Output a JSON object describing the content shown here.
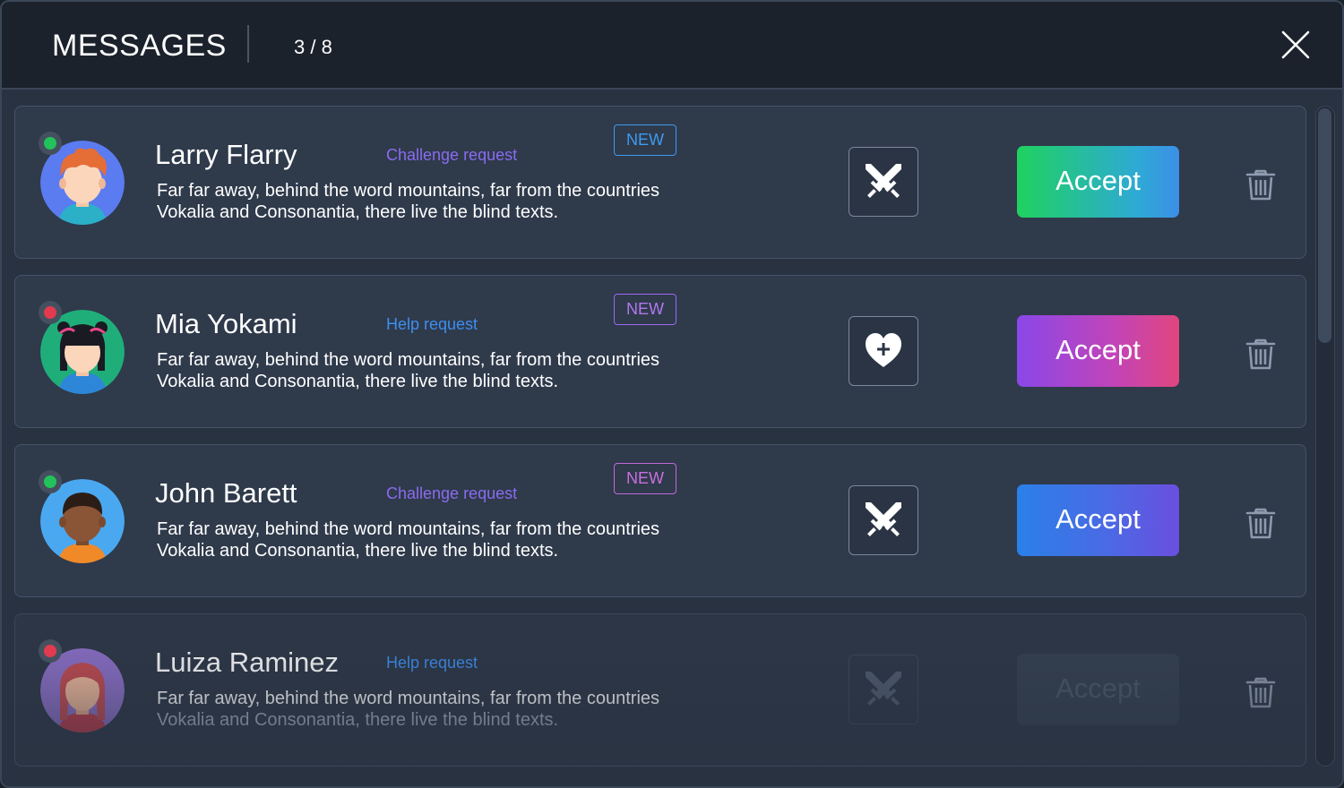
{
  "header": {
    "title": "MESSAGES",
    "counter": "3 / 8"
  },
  "colors": {
    "challenge_request": "#8a6cf0",
    "help_request": "#3d8ef0",
    "online": "#21c35a",
    "offline": "#e23a4e"
  },
  "messages": [
    {
      "name": "Larry Flarry",
      "request": "Challenge request",
      "badge": "NEW",
      "text_line1": "Far far away, behind the word mountains, far from the countries",
      "text_line2": "Vokalia and Consonantia, there live the blind texts.",
      "action_icon": "crossed-swords-icon",
      "accept_label": "Accept",
      "status": "online"
    },
    {
      "name": "Mia Yokami",
      "request": "Help request",
      "badge": "NEW",
      "text_line1": "Far far away, behind the word mountains, far from the countries",
      "text_line2": "Vokalia and Consonantia, there live the blind texts.",
      "action_icon": "heart-plus-icon",
      "accept_label": "Accept",
      "status": "offline"
    },
    {
      "name": "John Barett",
      "request": "Challenge request",
      "badge": "NEW",
      "text_line1": "Far far away, behind the word mountains, far from the countries",
      "text_line2": "Vokalia and Consonantia, there live the blind texts.",
      "action_icon": "crossed-swords-icon",
      "accept_label": "Accept",
      "status": "online"
    },
    {
      "name": "Luiza Raminez",
      "request": "Help request",
      "text_line1": "Far far away, behind the word mountains, far from the countries",
      "text_line2": "Vokalia and Consonantia, there live the blind texts.",
      "action_icon": "crossed-swords-icon",
      "accept_label": "Accept",
      "status": "offline"
    }
  ]
}
